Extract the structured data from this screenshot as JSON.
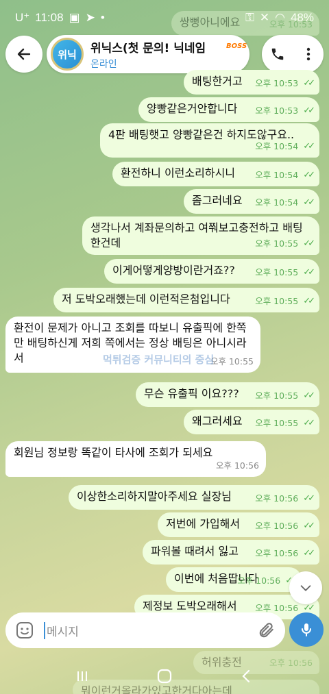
{
  "status_bar": {
    "carrier": "U⁺",
    "time": "11:08",
    "battery": "48%"
  },
  "header": {
    "avatar_text": "위닉",
    "name": "위닉스(첫 문의! 닉네임",
    "status": "온라인",
    "badge": "BOSS"
  },
  "faded_top": {
    "text": "쌍뻥아니에요",
    "time": "오후 10:53"
  },
  "messages": [
    {
      "dir": "out",
      "text": "배팅한거고",
      "time": "오후 10:53"
    },
    {
      "dir": "out",
      "text": "양빵같은거안합니다",
      "time": "오후 10:53"
    },
    {
      "dir": "out",
      "text": "4판 배팅햇고 양빵같은건 하지도않구요..",
      "time": "오후 10:54"
    },
    {
      "dir": "out",
      "text": "환전하니 이런소리하시니",
      "time": "오후 10:54"
    },
    {
      "dir": "out",
      "text": "좀그러네요",
      "time": "오후 10:54"
    },
    {
      "dir": "out",
      "text": "생각나서 계좌문의하고 여쭤보고충전하고 배팅한건데",
      "time": "오후 10:55"
    },
    {
      "dir": "out",
      "text": "이게어떻게양방이란거죠??",
      "time": "오후 10:55"
    },
    {
      "dir": "out",
      "text": "저 도박오래했는데 이런적은첨입니다",
      "time": "오후 10:55"
    },
    {
      "dir": "in",
      "text": "환전이 문제가 아니고 조회를 따보니 유출픽에 한쪽만 배팅하신게 저희 쪽에서는 정상 배팅은 아니시라서",
      "time": "오후 10:55"
    },
    {
      "dir": "out",
      "text": "무슨 유출픽 이요???",
      "time": "오후 10:55"
    },
    {
      "dir": "out",
      "text": "왜그러세요",
      "time": "오후 10:55"
    },
    {
      "dir": "in",
      "text": "회원님 정보랑 똑같이 타사에 조회가 되세요",
      "time": "오후 10:56"
    },
    {
      "dir": "out",
      "text": "이상한소리하지말아주세요 실장님",
      "time": "오후 10:56"
    },
    {
      "dir": "out",
      "text": "저번에 가입해서",
      "time": "오후 10:56"
    },
    {
      "dir": "out",
      "text": "파워볼 때려서 잃고",
      "time": "오후 10:56"
    },
    {
      "dir": "out",
      "text": "이번에 처음땁니다",
      "time": "오후 10:56"
    },
    {
      "dir": "out",
      "text": "제정보 도박오래해서",
      "time": "오후 10:56"
    }
  ],
  "faded_bottom": [
    {
      "text": "허위충전",
      "time": "오후 10:56"
    },
    {
      "text": "뭐이런거올라가있고한거다아는데"
    }
  ],
  "watermark": "먹튀검증 커뮤니티의 중심",
  "input": {
    "placeholder": "메시지"
  }
}
